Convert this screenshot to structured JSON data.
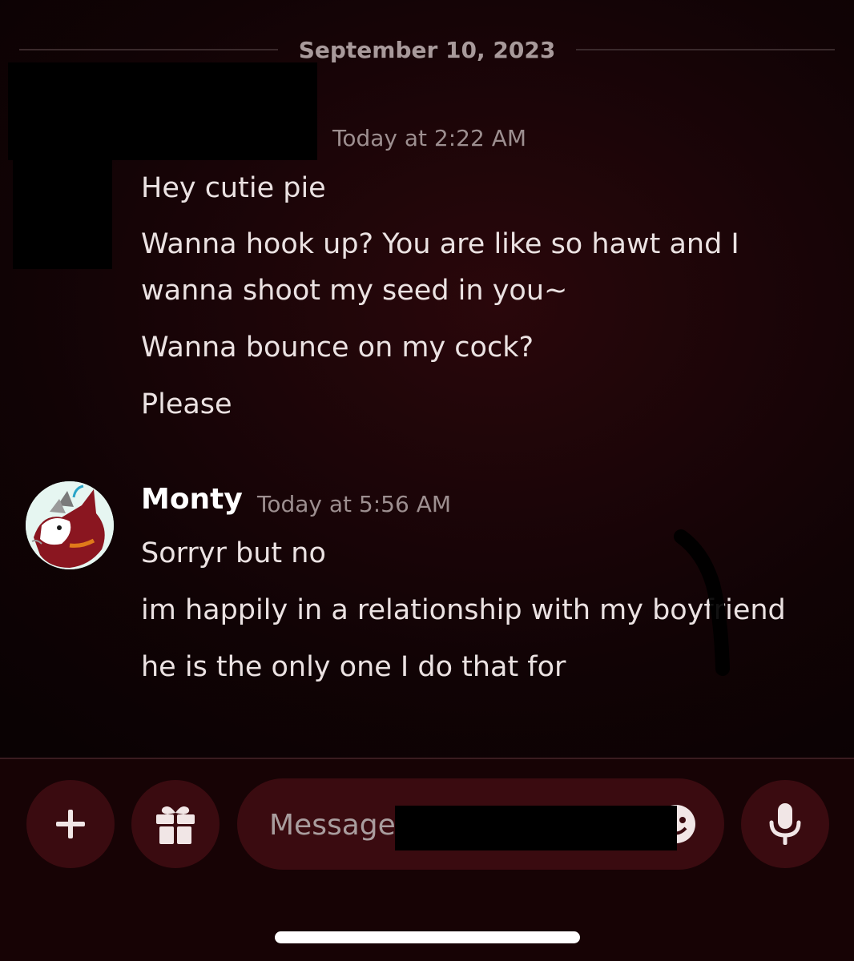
{
  "date_divider": "September 10, 2023",
  "messages": [
    {
      "timestamp": "Today at 2:22 AM",
      "lines": [
        "Hey cutie pie",
        "Wanna hook up? You are like so hawt and I\nwanna shoot my seed in you~",
        "Wanna bounce on my cock?",
        "Please"
      ]
    },
    {
      "username": "Monty",
      "timestamp": "Today at 5:56 AM",
      "lines": [
        "Sorryr but no",
        "im happily in a relationship with my boyfriend",
        "he is the only one I do that for"
      ]
    }
  ],
  "composer": {
    "placeholder": "Message"
  },
  "colors": {
    "background": "#170305",
    "button_bg": "#3a0b10",
    "text": "#ebe2e2",
    "muted": "#9d8f90"
  },
  "icons": {
    "add": "plus-icon",
    "gift": "gift-icon",
    "emoji": "emoji-icon",
    "voice": "microphone-icon"
  }
}
